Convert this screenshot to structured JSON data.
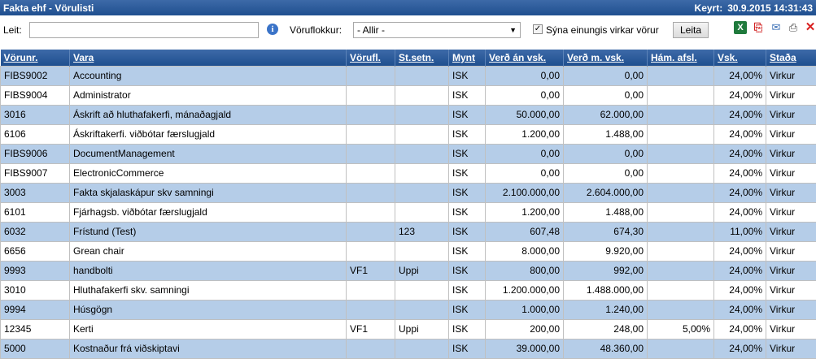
{
  "window": {
    "title": "Fakta ehf - Vörulisti",
    "run_label": "Keyrt:",
    "run_time": "30.9.2015 14:31:43"
  },
  "toolbar": {
    "search_label": "Leit:",
    "search_value": "",
    "category_label": "Vöruflokkur:",
    "category_selected": "- Allir -",
    "only_active_label": "Sýna einungis virkar vörur",
    "only_active_checked": true,
    "search_button_label": "Leita",
    "icons": [
      "excel-icon",
      "pdf-icon",
      "mail-icon",
      "print-icon",
      "close-icon"
    ]
  },
  "table": {
    "headers": [
      "Vörunr.",
      "Vara",
      "Vörufl.",
      "St.setn.",
      "Mynt",
      "Verð án vsk.",
      "Verð m. vsk.",
      "Hám. afsl.",
      "Vsk.",
      "Staða"
    ],
    "rows": [
      [
        "FIBS9002",
        "Accounting",
        "",
        "",
        "ISK",
        "0,00",
        "0,00",
        "",
        "24,00%",
        "Virkur"
      ],
      [
        "FIBS9004",
        "Administrator",
        "",
        "",
        "ISK",
        "0,00",
        "0,00",
        "",
        "24,00%",
        "Virkur"
      ],
      [
        "3016",
        "Áskrift að hluthafakerfi, mánaðagjald",
        "",
        "",
        "ISK",
        "50.000,00",
        "62.000,00",
        "",
        "24,00%",
        "Virkur"
      ],
      [
        "6106",
        "Áskriftakerfi. viðbótar færslugjald",
        "",
        "",
        "ISK",
        "1.200,00",
        "1.488,00",
        "",
        "24,00%",
        "Virkur"
      ],
      [
        "FIBS9006",
        "DocumentManagement",
        "",
        "",
        "ISK",
        "0,00",
        "0,00",
        "",
        "24,00%",
        "Virkur"
      ],
      [
        "FIBS9007",
        "ElectronicCommerce",
        "",
        "",
        "ISK",
        "0,00",
        "0,00",
        "",
        "24,00%",
        "Virkur"
      ],
      [
        "3003",
        "Fakta skjalaskápur skv samningi",
        "",
        "",
        "ISK",
        "2.100.000,00",
        "2.604.000,00",
        "",
        "24,00%",
        "Virkur"
      ],
      [
        "6101",
        "Fjárhagsb. viðbótar færslugjald",
        "",
        "",
        "ISK",
        "1.200,00",
        "1.488,00",
        "",
        "24,00%",
        "Virkur"
      ],
      [
        "6032",
        "Frístund (Test)",
        "",
        "123",
        "ISK",
        "607,48",
        "674,30",
        "",
        "11,00%",
        "Virkur"
      ],
      [
        "6656",
        "Grean chair",
        "",
        "",
        "ISK",
        "8.000,00",
        "9.920,00",
        "",
        "24,00%",
        "Virkur"
      ],
      [
        "9993",
        "handbolti",
        "VF1",
        "Uppi",
        "ISK",
        "800,00",
        "992,00",
        "",
        "24,00%",
        "Virkur"
      ],
      [
        "3010",
        "Hluthafakerfi skv. samningi",
        "",
        "",
        "ISK",
        "1.200.000,00",
        "1.488.000,00",
        "",
        "24,00%",
        "Virkur"
      ],
      [
        "9994",
        "Húsgögn",
        "",
        "",
        "ISK",
        "1.000,00",
        "1.240,00",
        "",
        "24,00%",
        "Virkur"
      ],
      [
        "12345",
        "Kerti",
        "VF1",
        "Uppi",
        "ISK",
        "200,00",
        "248,00",
        "5,00%",
        "24,00%",
        "Virkur"
      ],
      [
        "5000",
        "Kostnaður frá viðskiptavi",
        "",
        "",
        "ISK",
        "39.000,00",
        "48.360,00",
        "",
        "24,00%",
        "Virkur"
      ]
    ]
  }
}
